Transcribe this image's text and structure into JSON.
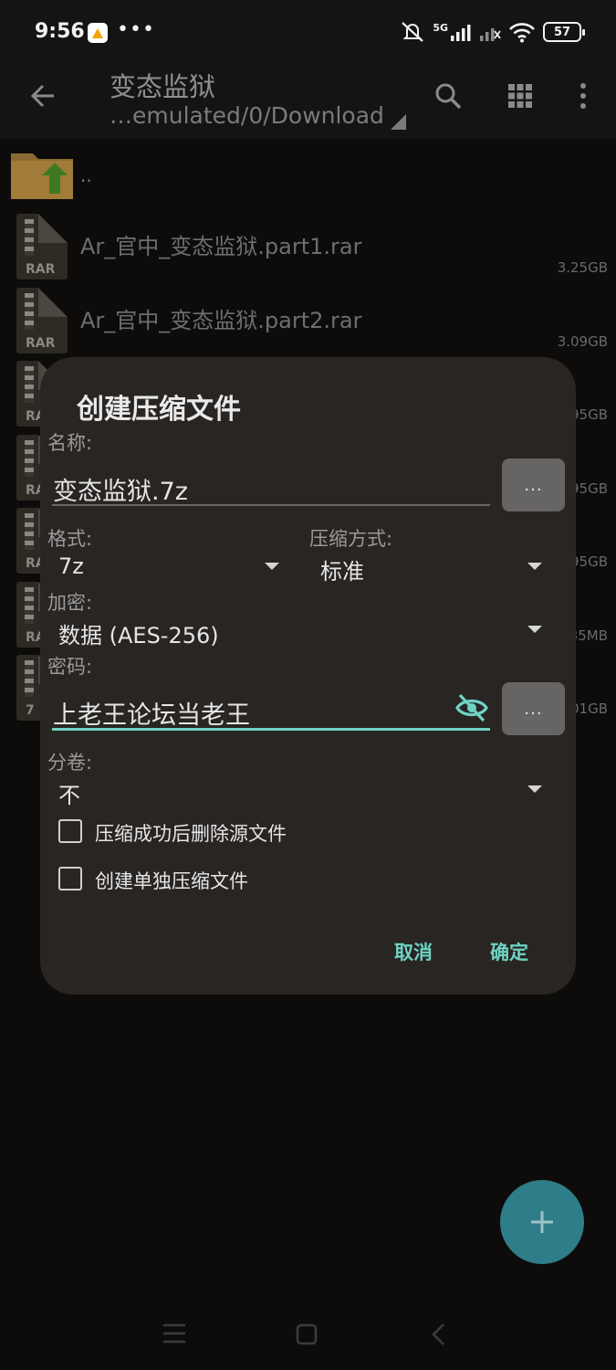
{
  "status_bar": {
    "time": "9:56",
    "network": "5G",
    "battery": "57"
  },
  "toolbar": {
    "title": "变态监狱",
    "path": "…emulated/0/Download",
    "icons": [
      "back-arrow-icon",
      "search-icon",
      "grid-icon",
      "more-vertical-icon"
    ]
  },
  "file_list": {
    "parent": "..",
    "items": [
      {
        "name": "Ar_官中_变态监狱.part1.rar",
        "size": "3.25GB",
        "type": "RAR"
      },
      {
        "name": "Ar_官中_变态监狱.part2.rar",
        "size": "3.09GB",
        "type": "RAR"
      },
      {
        "name": "",
        "size": "95GB",
        "type": "RA"
      },
      {
        "name": "",
        "size": "95GB",
        "type": "RA"
      },
      {
        "name": "",
        "size": "95GB",
        "type": "RA"
      },
      {
        "name": "",
        "size": "35MB",
        "type": "RA"
      },
      {
        "name": "",
        "size": "01GB",
        "type": "7"
      }
    ]
  },
  "dialog": {
    "title": "创建压缩文件",
    "name_label": "名称:",
    "name_value": "变态监狱.7z",
    "name_button": "...",
    "format_label": "格式:",
    "format_value": "7z",
    "method_label": "压缩方式:",
    "method_value": "标准",
    "encryption_label": "加密:",
    "encryption_value": "数据 (AES-256)",
    "password_label": "密码:",
    "password_value": "上老王论坛当老王",
    "password_button": "...",
    "split_label": "分卷:",
    "split_value": "不",
    "delete_source_label": "压缩成功后删除源文件",
    "delete_source_checked": false,
    "separate_archives_label": "创建单独压缩文件",
    "separate_archives_checked": false,
    "cancel_label": "取消",
    "ok_label": "确定"
  },
  "fab": {
    "icon": "plus-icon"
  },
  "colors": {
    "accent": "#6fd3c4",
    "fab": "#2f7d88",
    "dialog_bg": "#282523",
    "background": "#0d0c0b"
  }
}
